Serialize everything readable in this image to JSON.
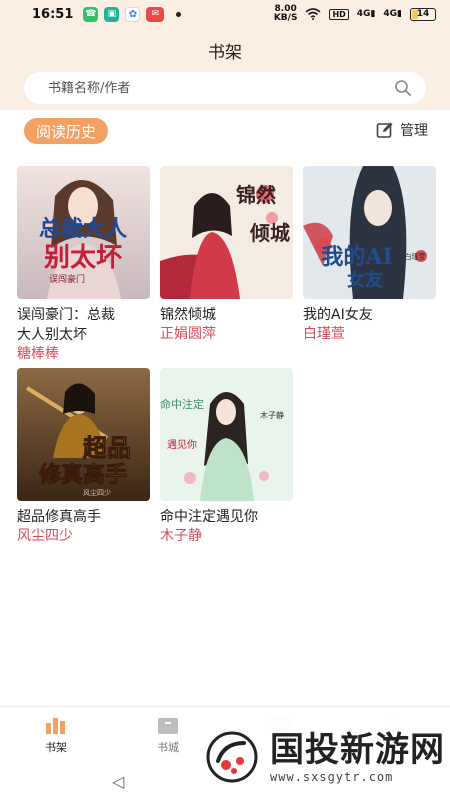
{
  "status_bar": {
    "time": "16:51",
    "net_speed": "8.00",
    "net_unit": "KB/S",
    "hd": "HD",
    "sig1": "4G",
    "sig2": "4G",
    "battery": "14"
  },
  "header": {
    "title": "书架",
    "search_placeholder": "书籍名称/作者"
  },
  "section": {
    "history_label": "阅读历史",
    "manage_label": "管理"
  },
  "books": [
    {
      "title_line1": "误闯豪门：总裁",
      "title_line2": "大人别太坏",
      "author": "糖棒棒",
      "cover_text1": "总裁大人",
      "cover_text2": "别太坏",
      "cover_sub": "误闯豪门",
      "cover_color": "#d8c7c9"
    },
    {
      "title_line1": "锦然倾城",
      "title_line2": "",
      "author": "正娟圆萍",
      "cover_text1": "锦然",
      "cover_text2": "倾城",
      "cover_sub": "",
      "cover_color": "#f1e6dc"
    },
    {
      "title_line1": "我的AI女友",
      "title_line2": "",
      "author": "白瑾萱",
      "cover_text1": "我的AI",
      "cover_text2": "女友",
      "cover_sub": "白瑾萱",
      "cover_color": "#dfe5ea"
    },
    {
      "title_line1": "超品修真高手",
      "title_line2": "",
      "author": "风尘四少",
      "cover_text1": "超品",
      "cover_text2": "修真高手",
      "cover_sub": "风尘四少",
      "cover_color": "#6b4a2a"
    },
    {
      "title_line1": "命中注定遇见你",
      "title_line2": "",
      "author": "木子静",
      "cover_text1": "命中注定",
      "cover_text2": "遇见你",
      "cover_sub": "木子静",
      "cover_color": "#e5f2e6"
    }
  ],
  "nav": [
    {
      "label": "书架",
      "icon": "bookshelf-icon"
    },
    {
      "label": "书城",
      "icon": "store-icon"
    },
    {
      "label": "",
      "icon": "category-icon"
    },
    {
      "label": "",
      "icon": "profile-icon"
    }
  ],
  "watermark": {
    "title": "国投新游网",
    "url": "www.sxsgytr.com"
  },
  "colors": {
    "accent": "#f3a163",
    "author": "#d94b5a",
    "header_bg": "#fbeee2"
  }
}
